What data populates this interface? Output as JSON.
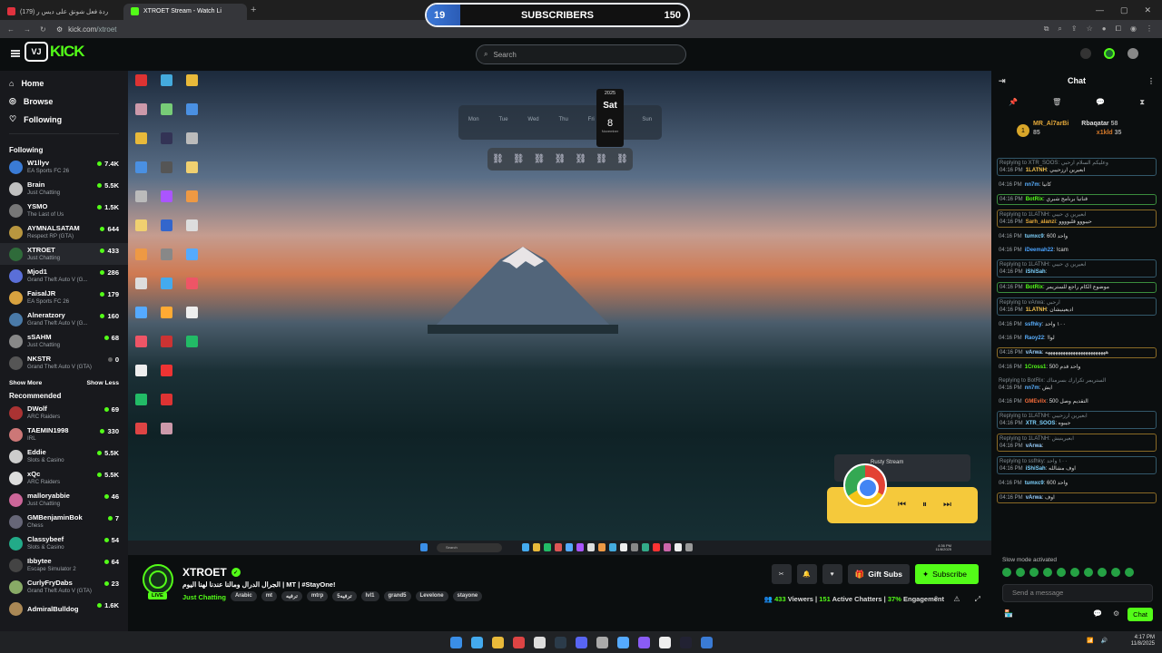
{
  "browser": {
    "tabs": [
      {
        "title": "(179) ردة فعل شونق على ديس ر",
        "color": "#e0323e"
      },
      {
        "title": "XTROET Stream - Watch Li",
        "color": "#53fc18"
      }
    ],
    "url_host": "kick.com",
    "url_path": "/xtroet"
  },
  "subs_goal": {
    "current": "19",
    "label": "SUBSCRIBERS",
    "goal": "150",
    "progress_fraction": 0.127
  },
  "header": {
    "logo_box": "VJ",
    "logo_text": "KICK",
    "search_placeholder": "Search"
  },
  "nav": {
    "home": "Home",
    "browse": "Browse",
    "following": "Following"
  },
  "following_section": {
    "title": "Following",
    "items": [
      {
        "name": "W1llyv",
        "category": "EA Sports FC 26",
        "viewers": "7.4K",
        "color": "#3a7bd5"
      },
      {
        "name": "Brain",
        "category": "Just Chatting",
        "viewers": "5.5K",
        "color": "#c0c0c0"
      },
      {
        "name": "YSMO",
        "category": "The Last of Us",
        "viewers": "1.5K",
        "color": "#777"
      },
      {
        "name": "AYMNALSATAM",
        "category": "Respect RP (GTA)",
        "viewers": "644",
        "color": "#b8963f"
      },
      {
        "name": "XTROET",
        "category": "Just Chatting",
        "viewers": "433",
        "color": "#2f6b3a"
      },
      {
        "name": "Mjod1",
        "category": "Grand Theft Auto V (G...",
        "viewers": "286",
        "color": "#5a6fd8"
      },
      {
        "name": "FaisalJR",
        "category": "EA Sports FC 26",
        "viewers": "179",
        "color": "#d8a23f"
      },
      {
        "name": "Alneratzory",
        "category": "Grand Theft Auto V (G...",
        "viewers": "160",
        "color": "#4a7aa8"
      },
      {
        "name": "sSAHM",
        "category": "Just Chatting",
        "viewers": "68",
        "color": "#888"
      },
      {
        "name": "NKSTR",
        "category": "Grand Theft Auto V (GTA)",
        "viewers": "0",
        "color": "#555"
      }
    ],
    "show_more": "Show More",
    "show_less": "Show Less"
  },
  "recommended_section": {
    "title": "Recommended",
    "items": [
      {
        "name": "DWolf",
        "category": "ARC Raiders",
        "viewers": "69",
        "color": "#a33"
      },
      {
        "name": "TAEMIN1998",
        "category": "IRL",
        "viewers": "330",
        "color": "#c77"
      },
      {
        "name": "Eddie",
        "category": "Slots & Casino",
        "viewers": "5.5K",
        "color": "#ccc"
      },
      {
        "name": "xQc",
        "category": "ARC Raiders",
        "viewers": "5.5K",
        "color": "#ddd"
      },
      {
        "name": "malloryabbie",
        "category": "Just Chatting",
        "viewers": "46",
        "color": "#c69"
      },
      {
        "name": "GMBenjaminBok",
        "category": "Chess",
        "viewers": "7",
        "color": "#667"
      },
      {
        "name": "Classybeef",
        "category": "Slots & Casino",
        "viewers": "54",
        "color": "#2a8"
      },
      {
        "name": "Ibbytee",
        "category": "Escape Simulator 2",
        "viewers": "64",
        "color": "#444"
      },
      {
        "name": "CurlyFryDabs",
        "category": "Grand Theft Auto V (GTA)",
        "viewers": "23",
        "color": "#8a6"
      },
      {
        "name": "AdmiralBulldog",
        "category": "",
        "viewers": "1.6K",
        "color": "#a85"
      }
    ]
  },
  "player": {
    "calendar_year": "2025",
    "calendar_day_name": "Sat",
    "calendar_date": "8",
    "calendar_month": "November",
    "weekdays": [
      "Mon",
      "Tue",
      "Wed",
      "Thu",
      "Fri",
      "Sat",
      "Sun"
    ],
    "media_title": "Rusty Stream",
    "win_search": "Search",
    "win_time": "4:36 PM",
    "win_date": "11/8/2025"
  },
  "stream": {
    "channel": "XTROET",
    "live_label": "LIVE",
    "title": "!MT | #StayOne | الجرال الدرال ومالنا عندنا لهنا اليوم",
    "category": "Just Chatting",
    "tags": [
      "Arabic",
      "mt",
      "ترفيه",
      "mtrp",
      "5ترفيه",
      "lvl1",
      "grand5",
      "Levelone",
      "stayone"
    ],
    "gift_label": "Gift Subs",
    "subscribe_label": "Subscribe",
    "viewers": "433",
    "viewers_label": "Viewers",
    "chatters": "151",
    "chatters_label": "Active Chatters",
    "engagement": "37%",
    "engagement_label": "Engagement"
  },
  "chat": {
    "title": "Chat",
    "top_gifters": [
      {
        "name": "MR_Al7arBi",
        "count": "85"
      },
      {
        "name": "Rbaqatar",
        "count": "58"
      },
      {
        "name": "x1kld",
        "count": "35"
      }
    ],
    "messages": [
      {
        "reply": "Replying to XTR_SOOS: وعليكم السلام ارحبي",
        "time": "04:16 PM",
        "user": "1LATNH",
        "ucolor": "#f2c14e",
        "text": "ابعيرين ارزحيبي",
        "style": "box"
      },
      {
        "reply": "",
        "time": "04:16 PM",
        "user": "nn7m",
        "ucolor": "#5ab0ff",
        "text": "كانيا",
        "style": ""
      },
      {
        "reply": "",
        "time": "04:16 PM",
        "user": "BotRix",
        "ucolor": "#53fc18",
        "text": "قناتيا برنامج شبري",
        "style": "hl"
      },
      {
        "reply": "Replying to 1LATNH: ابعيرين ي حيبي",
        "time": "04:16 PM",
        "user": "Sarh_alanzi",
        "ucolor": "#e5a93a",
        "text": "حيبووو قلبوووو",
        "style": "gold"
      },
      {
        "reply": "",
        "time": "04:16 PM",
        "user": "tumxc9",
        "ucolor": "#7fd3ff",
        "text": "600 واحد",
        "style": ""
      },
      {
        "reply": "",
        "time": "04:16 PM",
        "user": "iDeemah22",
        "ucolor": "#4aa3ff",
        "text": "!cam",
        "style": ""
      },
      {
        "reply": "Replying to 1LATNH: ابعيرين ي حيبي",
        "time": "04:16 PM",
        "user": "iShiSah",
        "ucolor": "#7fd3ff",
        "text": "",
        "style": "box"
      },
      {
        "reply": "",
        "time": "04:16 PM",
        "user": "BotRix",
        "ucolor": "#53fc18",
        "text": "موضوع الكام راجع للستريمر",
        "style": "hl"
      },
      {
        "reply": "Replying to vArwa: ارحبي",
        "time": "04:16 PM",
        "user": "1LATNH",
        "ucolor": "#f2c14e",
        "text": "اديعينيشان",
        "style": "box"
      },
      {
        "reply": "",
        "time": "04:16 PM",
        "user": "ssfhky",
        "ucolor": "#5ab0ff",
        "text": "١٠٠ واحد",
        "style": ""
      },
      {
        "reply": "",
        "time": "04:16 PM",
        "user": "Raoy22",
        "ucolor": "#5ab0ff",
        "text": "!لوا",
        "style": ""
      },
      {
        "reply": "",
        "time": "04:16 PM",
        "user": "vArwa",
        "ucolor": "#9ad0ff",
        "text": "ههههههههههههههههههههههههه",
        "style": "gold"
      },
      {
        "reply": "",
        "time": "04:16 PM",
        "user": "1Cross1",
        "ucolor": "#53fc18",
        "text": "واحد قدم 500",
        "style": ""
      },
      {
        "reply": "Replying to BotRix: الستريمر تكرارك بسرمناك",
        "time": "04:16 PM",
        "user": "nn7m",
        "ucolor": "#5ab0ff",
        "text": "ايش",
        "style": ""
      },
      {
        "reply": "",
        "time": "04:16 PM",
        "user": "GMEvilx",
        "ucolor": "#f26b3a",
        "text": "التقديم وصل 500",
        "style": ""
      },
      {
        "reply": "Replying to 1LATNH: ابعيرين ارزحيبي",
        "time": "04:16 PM",
        "user": "XTR_SOOS",
        "ucolor": "#7fd3ff",
        "text": "جيبوه",
        "style": "box"
      },
      {
        "reply": "Replying to 1LATNH: ابعيرينيش",
        "time": "04:16 PM",
        "user": "vArwa",
        "ucolor": "#9ad0ff",
        "text": "",
        "style": "gold"
      },
      {
        "reply": "Replying to ssfhky: ١٠٠ واحد",
        "time": "04:16 PM",
        "user": "iShiSah",
        "ucolor": "#7fd3ff",
        "text": "اوف مشالله",
        "style": "box"
      },
      {
        "reply": "",
        "time": "04:16 PM",
        "user": "tumxc9",
        "ucolor": "#7fd3ff",
        "text": "600 واحد",
        "style": ""
      },
      {
        "reply": "",
        "time": "04:16 PM",
        "user": "vArwa",
        "ucolor": "#9ad0ff",
        "text": "اوف",
        "style": "gold"
      }
    ],
    "slow_mode": "Slow mode activated",
    "input_placeholder": "Send a message",
    "send_label": "Chat"
  },
  "taskbar": {
    "time": "4:17 PM",
    "date": "11/8/2025"
  }
}
